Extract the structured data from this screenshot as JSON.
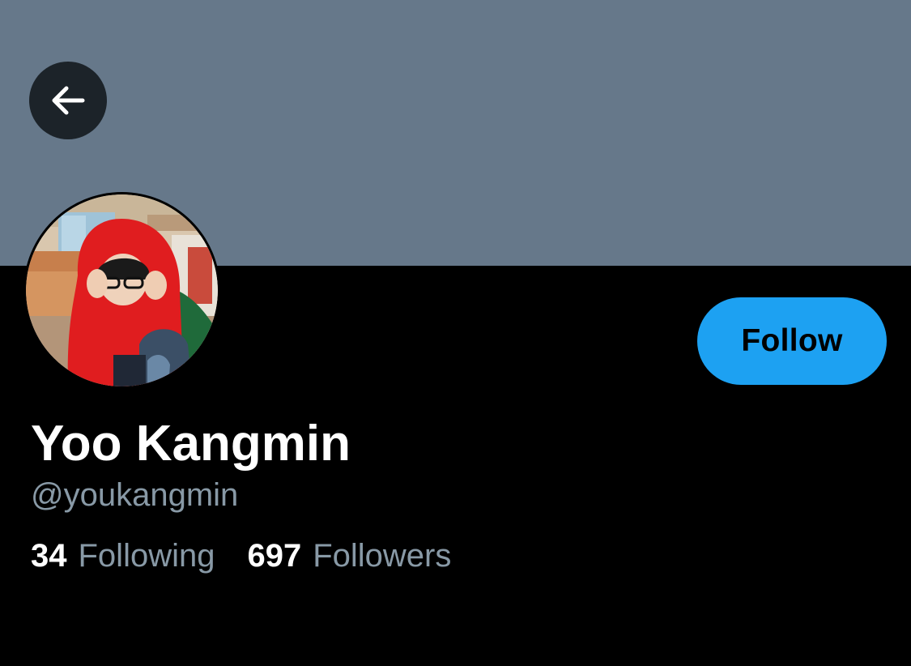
{
  "profile": {
    "display_name": "Yoo Kangmin",
    "handle": "@youkangmin",
    "following_count": "34",
    "following_label": "Following",
    "followers_count": "697",
    "followers_label": "Followers"
  },
  "actions": {
    "follow_label": "Follow"
  },
  "icons": {
    "back": "arrow-left-icon"
  },
  "colors": {
    "banner": "#66788a",
    "background": "#000000",
    "accent": "#1da1f2",
    "secondary_text": "#8899a6",
    "primary_text": "#ffffff"
  }
}
